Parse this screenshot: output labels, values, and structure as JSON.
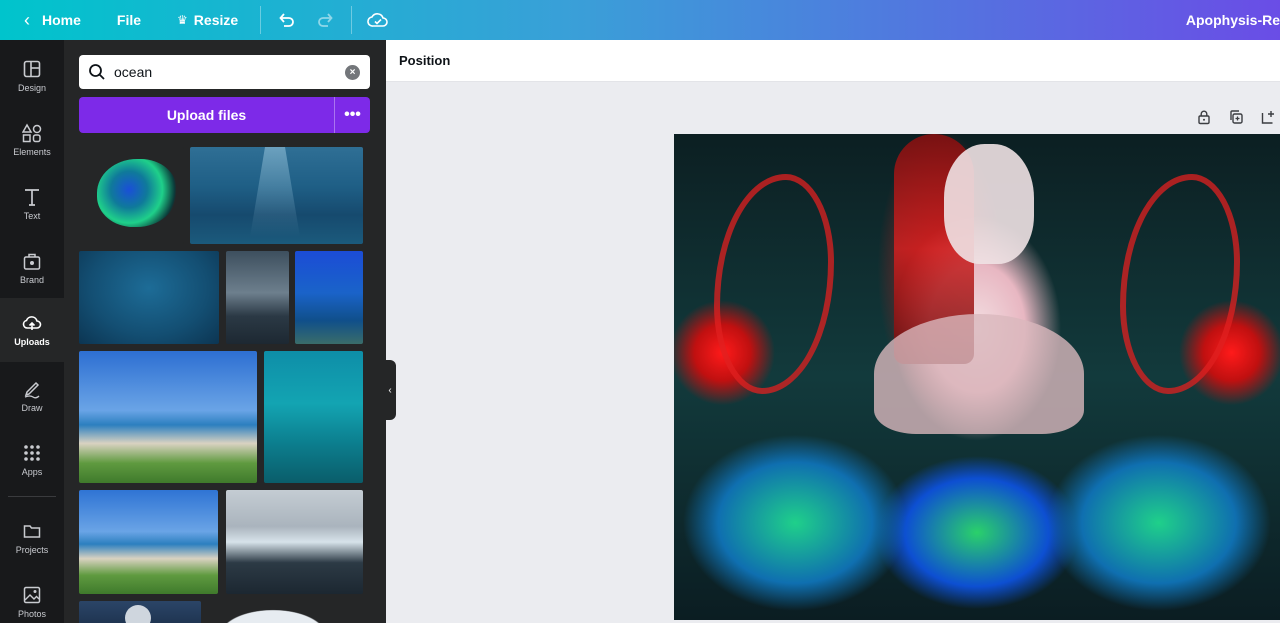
{
  "topbar": {
    "home_label": "Home",
    "file_label": "File",
    "resize_label": "Resize",
    "design_title": "Apophysis-Re"
  },
  "rail": {
    "items": [
      {
        "label": "Design",
        "icon": "design-icon"
      },
      {
        "label": "Elements",
        "icon": "elements-icon"
      },
      {
        "label": "Text",
        "icon": "text-icon"
      },
      {
        "label": "Brand",
        "icon": "brand-icon"
      },
      {
        "label": "Uploads",
        "icon": "upload-cloud-icon",
        "active": true
      },
      {
        "label": "Draw",
        "icon": "draw-icon"
      },
      {
        "label": "Apps",
        "icon": "apps-icon"
      },
      {
        "label": "Projects",
        "icon": "folder-icon"
      },
      {
        "label": "Photos",
        "icon": "photos-icon"
      }
    ]
  },
  "panel": {
    "search": {
      "value": "ocean",
      "placeholder": ""
    },
    "upload_label": "Upload files",
    "more_label": "•••"
  },
  "editor": {
    "toolbar_position_label": "Position"
  },
  "colors": {
    "accent_purple": "#7d2ae8",
    "topbar_start": "#00c4cc",
    "topbar_end": "#6a4de6",
    "panel_bg": "#252627",
    "rail_bg": "#18191b",
    "canvas_bg": "#ebecf0"
  }
}
